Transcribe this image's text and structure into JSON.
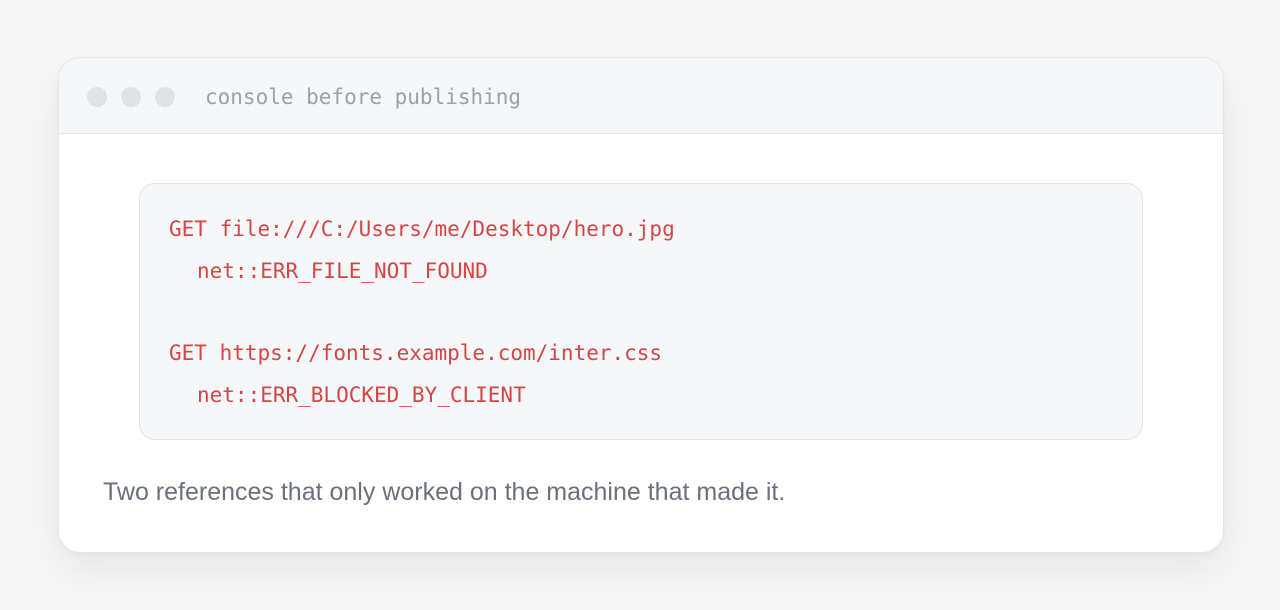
{
  "window": {
    "title": "console before publishing",
    "controls": [
      {
        "icon": "window-dot-icon"
      },
      {
        "icon": "window-dot-icon"
      },
      {
        "icon": "window-dot-icon"
      }
    ]
  },
  "console": {
    "lines": [
      "GET file:///C:/Users/me/Desktop/hero.jpg",
      "net::ERR_FILE_NOT_FOUND",
      "GET https://fonts.example.com/inter.css",
      "net::ERR_BLOCKED_BY_CLIENT"
    ],
    "error_color": "#d64545"
  },
  "caption": "Two references that only worked on the machine that made it."
}
